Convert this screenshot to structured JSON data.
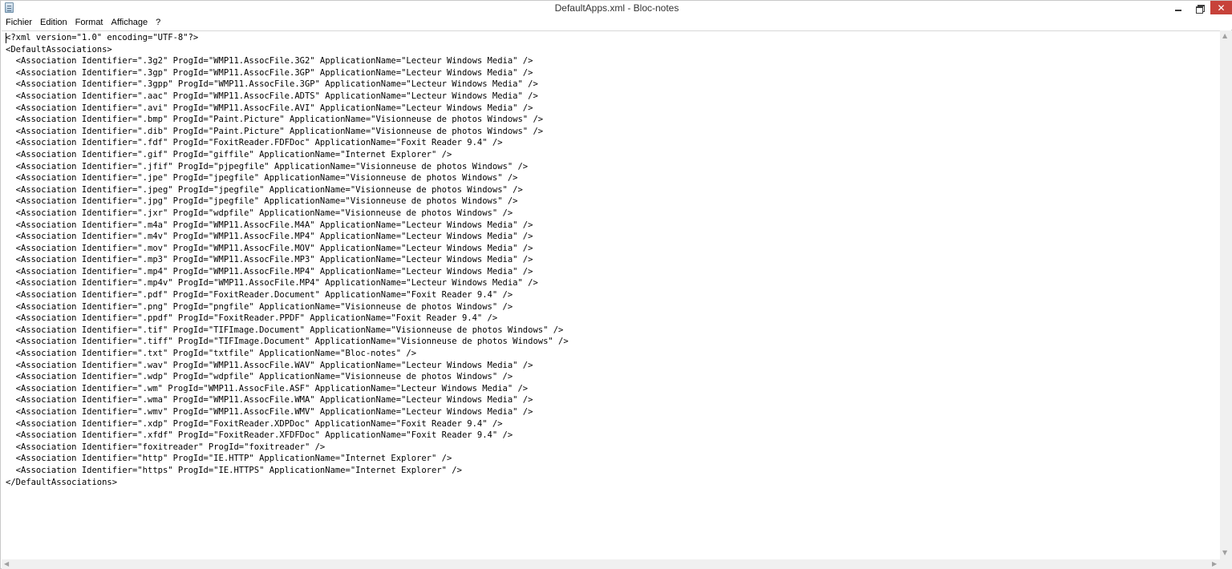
{
  "window": {
    "title": "DefaultApps.xml - Bloc-notes",
    "close_glyph": "✕"
  },
  "menu": {
    "items": [
      "Fichier",
      "Edition",
      "Format",
      "Affichage",
      "?"
    ]
  },
  "editor": {
    "lines": [
      "<?xml version=\"1.0\" encoding=\"UTF-8\"?>",
      "<DefaultAssociations>",
      "  <Association Identifier=\".3g2\" ProgId=\"WMP11.AssocFile.3G2\" ApplicationName=\"Lecteur Windows Media\" />",
      "  <Association Identifier=\".3gp\" ProgId=\"WMP11.AssocFile.3GP\" ApplicationName=\"Lecteur Windows Media\" />",
      "  <Association Identifier=\".3gpp\" ProgId=\"WMP11.AssocFile.3GP\" ApplicationName=\"Lecteur Windows Media\" />",
      "  <Association Identifier=\".aac\" ProgId=\"WMP11.AssocFile.ADTS\" ApplicationName=\"Lecteur Windows Media\" />",
      "  <Association Identifier=\".avi\" ProgId=\"WMP11.AssocFile.AVI\" ApplicationName=\"Lecteur Windows Media\" />",
      "  <Association Identifier=\".bmp\" ProgId=\"Paint.Picture\" ApplicationName=\"Visionneuse de photos Windows\" />",
      "  <Association Identifier=\".dib\" ProgId=\"Paint.Picture\" ApplicationName=\"Visionneuse de photos Windows\" />",
      "  <Association Identifier=\".fdf\" ProgId=\"FoxitReader.FDFDoc\" ApplicationName=\"Foxit Reader 9.4\" />",
      "  <Association Identifier=\".gif\" ProgId=\"giffile\" ApplicationName=\"Internet Explorer\" />",
      "  <Association Identifier=\".jfif\" ProgId=\"pjpegfile\" ApplicationName=\"Visionneuse de photos Windows\" />",
      "  <Association Identifier=\".jpe\" ProgId=\"jpegfile\" ApplicationName=\"Visionneuse de photos Windows\" />",
      "  <Association Identifier=\".jpeg\" ProgId=\"jpegfile\" ApplicationName=\"Visionneuse de photos Windows\" />",
      "  <Association Identifier=\".jpg\" ProgId=\"jpegfile\" ApplicationName=\"Visionneuse de photos Windows\" />",
      "  <Association Identifier=\".jxr\" ProgId=\"wdpfile\" ApplicationName=\"Visionneuse de photos Windows\" />",
      "  <Association Identifier=\".m4a\" ProgId=\"WMP11.AssocFile.M4A\" ApplicationName=\"Lecteur Windows Media\" />",
      "  <Association Identifier=\".m4v\" ProgId=\"WMP11.AssocFile.MP4\" ApplicationName=\"Lecteur Windows Media\" />",
      "  <Association Identifier=\".mov\" ProgId=\"WMP11.AssocFile.MOV\" ApplicationName=\"Lecteur Windows Media\" />",
      "  <Association Identifier=\".mp3\" ProgId=\"WMP11.AssocFile.MP3\" ApplicationName=\"Lecteur Windows Media\" />",
      "  <Association Identifier=\".mp4\" ProgId=\"WMP11.AssocFile.MP4\" ApplicationName=\"Lecteur Windows Media\" />",
      "  <Association Identifier=\".mp4v\" ProgId=\"WMP11.AssocFile.MP4\" ApplicationName=\"Lecteur Windows Media\" />",
      "  <Association Identifier=\".pdf\" ProgId=\"FoxitReader.Document\" ApplicationName=\"Foxit Reader 9.4\" />",
      "  <Association Identifier=\".png\" ProgId=\"pngfile\" ApplicationName=\"Visionneuse de photos Windows\" />",
      "  <Association Identifier=\".ppdf\" ProgId=\"FoxitReader.PPDF\" ApplicationName=\"Foxit Reader 9.4\" />",
      "  <Association Identifier=\".tif\" ProgId=\"TIFImage.Document\" ApplicationName=\"Visionneuse de photos Windows\" />",
      "  <Association Identifier=\".tiff\" ProgId=\"TIFImage.Document\" ApplicationName=\"Visionneuse de photos Windows\" />",
      "  <Association Identifier=\".txt\" ProgId=\"txtfile\" ApplicationName=\"Bloc-notes\" />",
      "  <Association Identifier=\".wav\" ProgId=\"WMP11.AssocFile.WAV\" ApplicationName=\"Lecteur Windows Media\" />",
      "  <Association Identifier=\".wdp\" ProgId=\"wdpfile\" ApplicationName=\"Visionneuse de photos Windows\" />",
      "  <Association Identifier=\".wm\" ProgId=\"WMP11.AssocFile.ASF\" ApplicationName=\"Lecteur Windows Media\" />",
      "  <Association Identifier=\".wma\" ProgId=\"WMP11.AssocFile.WMA\" ApplicationName=\"Lecteur Windows Media\" />",
      "  <Association Identifier=\".wmv\" ProgId=\"WMP11.AssocFile.WMV\" ApplicationName=\"Lecteur Windows Media\" />",
      "  <Association Identifier=\".xdp\" ProgId=\"FoxitReader.XDPDoc\" ApplicationName=\"Foxit Reader 9.4\" />",
      "  <Association Identifier=\".xfdf\" ProgId=\"FoxitReader.XFDFDoc\" ApplicationName=\"Foxit Reader 9.4\" />",
      "  <Association Identifier=\"foxitreader\" ProgId=\"foxitreader\" />",
      "  <Association Identifier=\"http\" ProgId=\"IE.HTTP\" ApplicationName=\"Internet Explorer\" />",
      "  <Association Identifier=\"https\" ProgId=\"IE.HTTPS\" ApplicationName=\"Internet Explorer\" />",
      "</DefaultAssociations>"
    ]
  },
  "scrollbars": {
    "up_glyph": "▲",
    "down_glyph": "▼",
    "left_glyph": "◀",
    "right_glyph": "▶"
  }
}
